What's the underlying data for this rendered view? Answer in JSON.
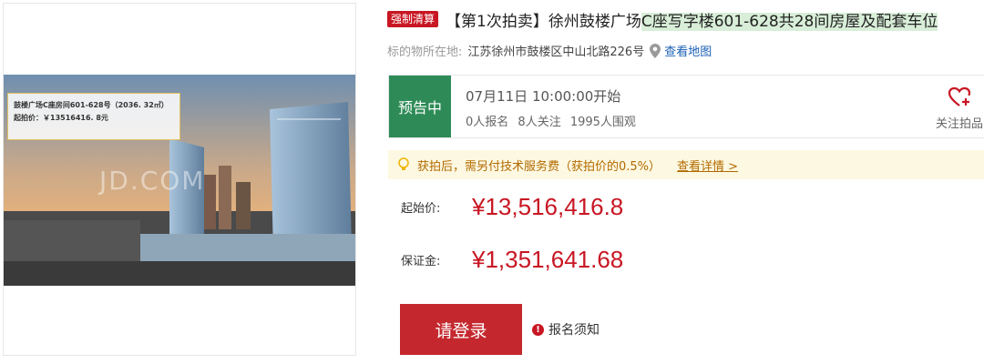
{
  "image": {
    "caption_line1": "鼓楼广场C座房间601-628号（2036. 32㎡）",
    "caption_line2": "起拍价：￥13516416. 8元",
    "watermark": "JD.COM"
  },
  "title": {
    "badge": "强制清算",
    "prefix": "【第1次拍卖】徐州鼓楼广场",
    "highlight": "C座写字楼601-628共28间房屋及配套车位"
  },
  "location": {
    "label": "标的物所在地:",
    "value": "江苏徐州市鼓楼区中山北路226号",
    "map_link": "查看地图"
  },
  "status": {
    "tag": "预告中",
    "time": "07月11日 10:00:00开始",
    "signups": "0人报名",
    "followers": "8人关注",
    "viewers": "1995人围观",
    "follow_label": "关注拍品"
  },
  "notice": {
    "text": "获拍后，需另付技术服务费（获拍价的0.5%）",
    "detail_link": "查看详情 >"
  },
  "prices": {
    "start_label": "起始价:",
    "start_value": "¥13,516,416.8",
    "deposit_label": "保证金:",
    "deposit_value": "¥1,351,641.68"
  },
  "actions": {
    "login_button": "请登录",
    "signup_notice": "报名须知"
  },
  "colors": {
    "accent_red": "#c81623",
    "status_green": "#2e8b57",
    "notice_bg": "#fdf8e1",
    "link_blue": "#1a5fb4"
  }
}
